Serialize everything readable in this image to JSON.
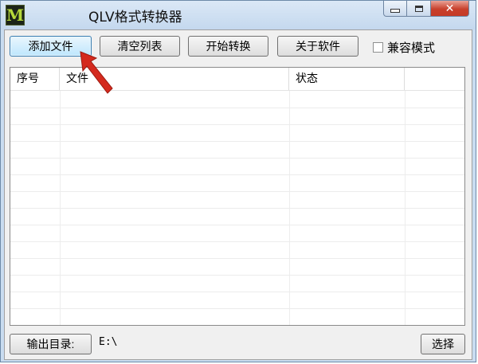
{
  "window": {
    "icon_letter": "M",
    "title": "QLV格式转换器",
    "controls": {
      "minimize": "minimize",
      "maximize": "maximize",
      "close": "✕"
    }
  },
  "toolbar": {
    "add_file": "添加文件",
    "clear_list": "清空列表",
    "start_convert": "开始转换",
    "about": "关于软件",
    "compat_mode_label": "兼容模式",
    "compat_mode_checked": false
  },
  "table": {
    "columns": [
      "序号",
      "文件",
      "状态",
      ""
    ],
    "rows": []
  },
  "footer": {
    "output_dir_button": "输出目录:",
    "output_path": "E:\\",
    "select_button": "选择"
  },
  "colors": {
    "window_frame": "#c9dcf0",
    "close_button": "#c8402c",
    "active_button": "#bee6fd",
    "pointer_arrow": "#d42a1e"
  }
}
